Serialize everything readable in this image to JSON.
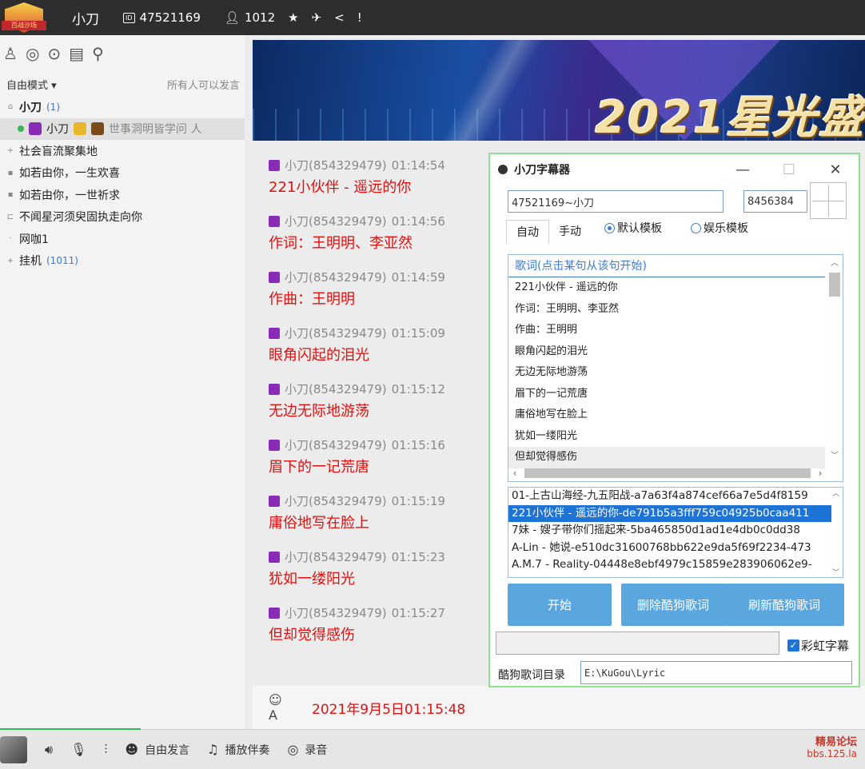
{
  "topbar": {
    "logo_text": "百战沙场",
    "username": "小刀",
    "room_id": "47521169",
    "members": "1012",
    "id_badge": "ID"
  },
  "left": {
    "mode": "自由模式",
    "mode_hint": "所有人可以发言",
    "tree": [
      {
        "label": "小刀",
        "count": "(1)"
      },
      {
        "label": "小刀",
        "signature": "世事洞明皆学问 人"
      },
      {
        "label": "社会盲流聚集地"
      },
      {
        "label": "如若由你，一生欢喜"
      },
      {
        "label": "如若由你，一世祈求"
      },
      {
        "label": "不闻星河须臾固执走向你"
      },
      {
        "label": "网咖1"
      },
      {
        "label": "挂机",
        "count": "(1011)"
      }
    ]
  },
  "banner": {
    "title": "2021星光盛"
  },
  "messages": [
    {
      "sender": "小刀(854329479)",
      "time": "01:14:54",
      "text": "221小伙伴 - 遥远的你"
    },
    {
      "sender": "小刀(854329479)",
      "time": "01:14:56",
      "text": "作词：王明明、李亚然"
    },
    {
      "sender": "小刀(854329479)",
      "time": "01:14:59",
      "text": "作曲：王明明"
    },
    {
      "sender": "小刀(854329479)",
      "time": "01:15:09",
      "text": "眼角闪起的泪光"
    },
    {
      "sender": "小刀(854329479)",
      "time": "01:15:12",
      "text": "无边无际地游荡"
    },
    {
      "sender": "小刀(854329479)",
      "time": "01:15:16",
      "text": "眉下的一记荒唐"
    },
    {
      "sender": "小刀(854329479)",
      "time": "01:15:19",
      "text": "庸俗地写在脸上"
    },
    {
      "sender": "小刀(854329479)",
      "time": "01:15:23",
      "text": "犹如一缕阳光"
    },
    {
      "sender": "小刀(854329479)",
      "time": "01:15:27",
      "text": "但却觉得感伤"
    }
  ],
  "inputbar": {
    "timestamp": "2021年9月5日01:15:48"
  },
  "bottombar": {
    "free_speech": "自由发言",
    "play_music": "播放伴奏",
    "record": "录音",
    "forum_name": "精易论坛",
    "forum_url": "bbs.125.la"
  },
  "lyric_window": {
    "title": "小刀字幕器",
    "room_field": "47521169~小刀",
    "num_field": "8456384",
    "tabs": [
      "自动",
      "手动"
    ],
    "templates": [
      "默认模板",
      "娱乐模板"
    ],
    "lyrics_header": "歌词(点击某句从该句开始)",
    "lyrics": [
      "221小伙伴 - 遥远的你",
      "作词：王明明、李亚然",
      "作曲：王明明",
      "眼角闪起的泪光",
      "无边无际地游荡",
      "眉下的一记荒唐",
      "庸俗地写在脸上",
      "犹如一缕阳光",
      "但却觉得感伤"
    ],
    "songs": [
      "01-上古山海经-九五阳战-a7a63f4a874cef66a7e5d4f8159",
      "221小伙伴 - 遥远的你-de791b5a3fff759c04925b0caa411",
      "7妹 - 嫂子带你们摇起来-5ba465850d1ad1e4db0c0dd38",
      "A-Lin - 她说-e510dc31600768bb622e9da5f69f2234-473",
      "A.M.7 - Reality-04448e8ebf4979c15859e283906062e9-"
    ],
    "btn_start": "开始",
    "btn_delete": "删除酷狗歌词",
    "btn_refresh": "刷新酷狗歌词",
    "rainbow_label": "彩虹字幕",
    "dir_label": "酷狗歌词目录",
    "dir_value": "E:\\KuGou\\Lyric"
  }
}
